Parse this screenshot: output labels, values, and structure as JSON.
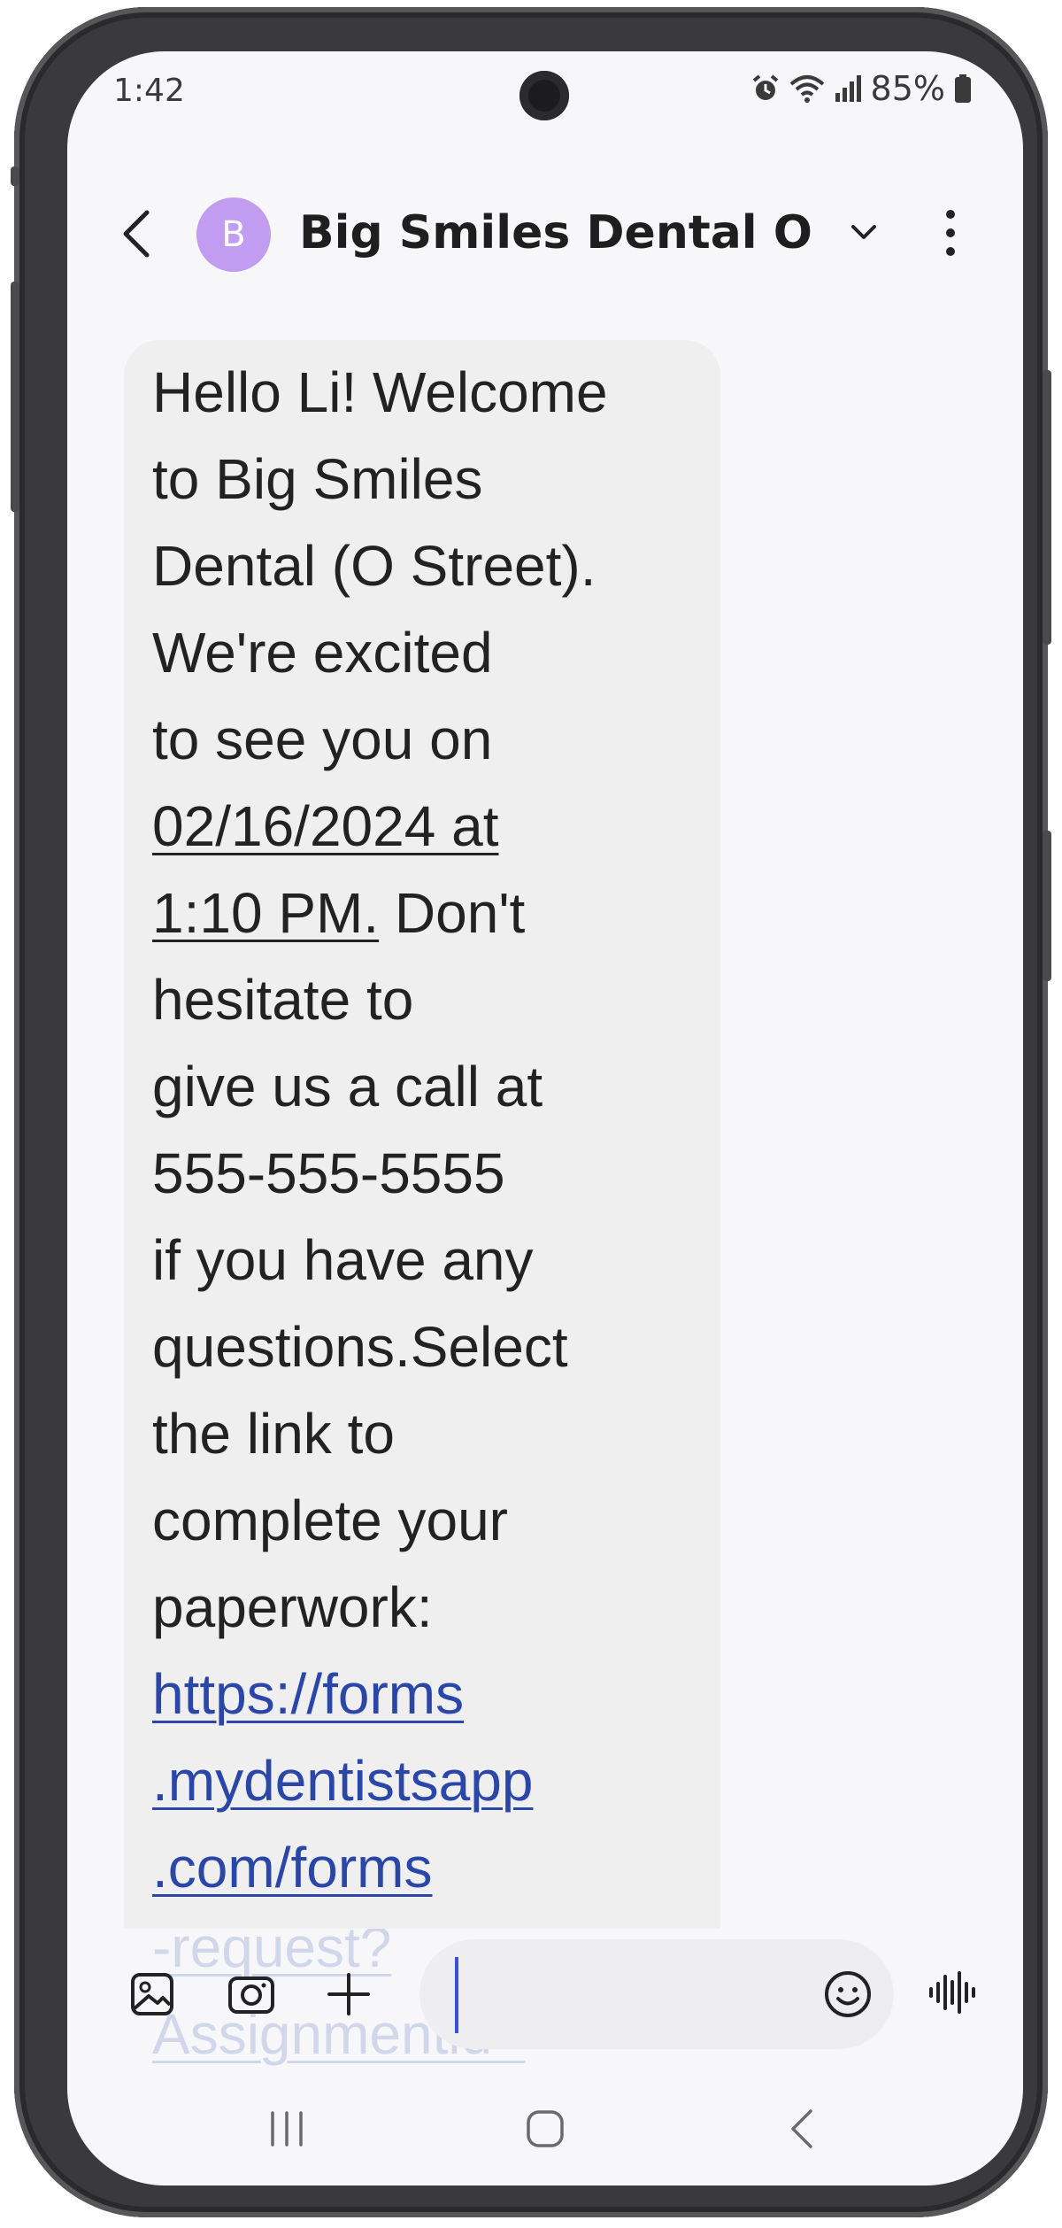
{
  "status_bar": {
    "time": "1:42",
    "battery": "85%",
    "icons": [
      "alarm-icon",
      "wifi-icon",
      "signal-icon",
      "battery-icon"
    ]
  },
  "header": {
    "avatar_letter": "B",
    "contact_name": "Big Smiles Dental O S...",
    "avatar_color": "#c29cf0"
  },
  "message": {
    "lines": [
      "Hello Li! Welcome",
      "to Big Smiles",
      "Dental (O Street).",
      "We're excited",
      "to see you on"
    ],
    "date_line1": "02/16/2024 at",
    "date_line2": "1:10 PM.",
    "after_date": " Don't",
    "lines2": [
      "hesitate to",
      "give us a call at",
      "555-555-5555",
      "if you have any",
      "questions.Select",
      "the link to",
      "complete your",
      "paperwork:"
    ],
    "link_lines": [
      "https://forms",
      ".mydentistsapp",
      ".com/forms",
      "-request?",
      "Assignmentid="
    ],
    "link_color": "#2a46a8"
  },
  "composer": {
    "icons": [
      "gallery-icon",
      "camera-icon",
      "plus-icon",
      "emoji-icon",
      "voice-input-icon"
    ],
    "input_value": ""
  },
  "nav_bar": {
    "icons": [
      "recent-apps-icon",
      "home-icon",
      "back-icon"
    ]
  }
}
